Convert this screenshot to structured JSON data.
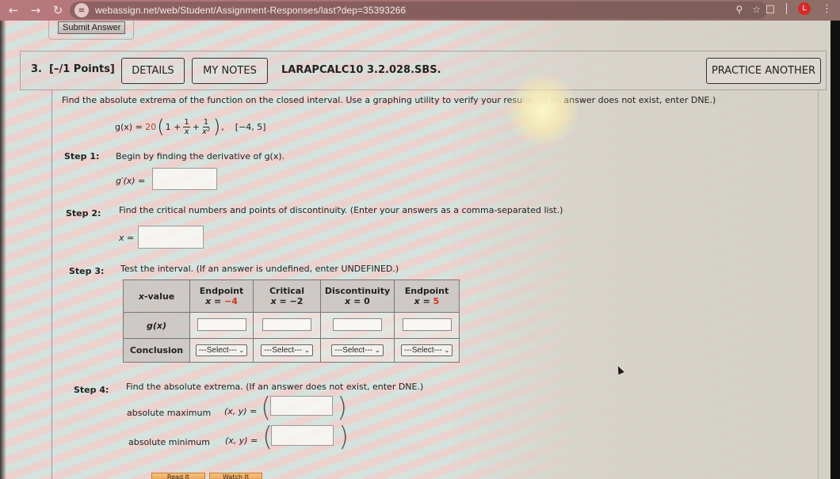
{
  "browser": {
    "url": "webassign.net/web/Student/Assignment-Responses/last?dep=35393266",
    "profile_initial": "L",
    "icons": [
      "back-icon",
      "forward-icon",
      "reload-icon",
      "site-info-icon",
      "zoom-icon",
      "bookmark-star-icon",
      "extensions-icon",
      "profile-avatar",
      "menu-kebab-icon"
    ]
  },
  "submit_button": "Submit Answer",
  "question": {
    "number": "3.",
    "points": "[–/1 Points]",
    "details_label": "DETAILS",
    "notes_label": "MY NOTES",
    "problem_id": "LARAPCALC10 3.2.028.SBS.",
    "practice_label": "PRACTICE ANOTHER",
    "prompt_main": "Find the absolute extrema of the function on the closed interval. Use a graphing utility to verify your resu",
    "prompt_faded": "lts. (If an ",
    "prompt_end": "answer does not exist, enter DNE.)",
    "function": {
      "lhs": "g(x) =",
      "coef": "20",
      "one": "1 +",
      "frac1_num": "1",
      "frac1_den": "x",
      "plus": "+",
      "frac2_num": "1",
      "frac2_den": "x²",
      "comma": ",",
      "interval": "[−4, 5]"
    }
  },
  "steps": [
    {
      "label": "Step 1:",
      "text": "Begin by finding the derivative of g(x).",
      "field_label": "g′(x) =",
      "value": ""
    },
    {
      "label": "Step 2:",
      "text": "Find the critical numbers and points of discontinuity. (Enter your answers as a comma-separated list.)",
      "field_label": "x =",
      "value": ""
    },
    {
      "label": "Step 3:",
      "text": "Test the interval. (If an answer is undefined, enter UNDEFINED.)"
    },
    {
      "label": "Step 4:",
      "text": "Find the absolute extrema. (If an answer does not exist, enter DNE.)",
      "max_label": "absolute maximum",
      "min_label": "absolute minimum",
      "xy_label": "(x, y) =",
      "max_value": "",
      "min_value": ""
    }
  ],
  "table": {
    "corner": "x-value",
    "columns": [
      {
        "type": "Endpoint",
        "eq": "x = ",
        "value": "−4",
        "value_red": true
      },
      {
        "type": "Critical",
        "eq": "x = ",
        "value": "−2",
        "value_red": false
      },
      {
        "type": "Discontinuity",
        "eq": "x = ",
        "value": "0",
        "value_red": false
      },
      {
        "type": "Endpoint",
        "eq": "x = ",
        "value": "5",
        "value_red": true
      }
    ],
    "row_g": "g(x)",
    "row_conclusion": "Conclusion",
    "select_placeholder": "---Select---"
  },
  "help_buttons": [
    "Read It",
    "Watch It"
  ],
  "colors": {
    "accent_red": "#d2321e",
    "help_orange": "#eaa04c"
  }
}
